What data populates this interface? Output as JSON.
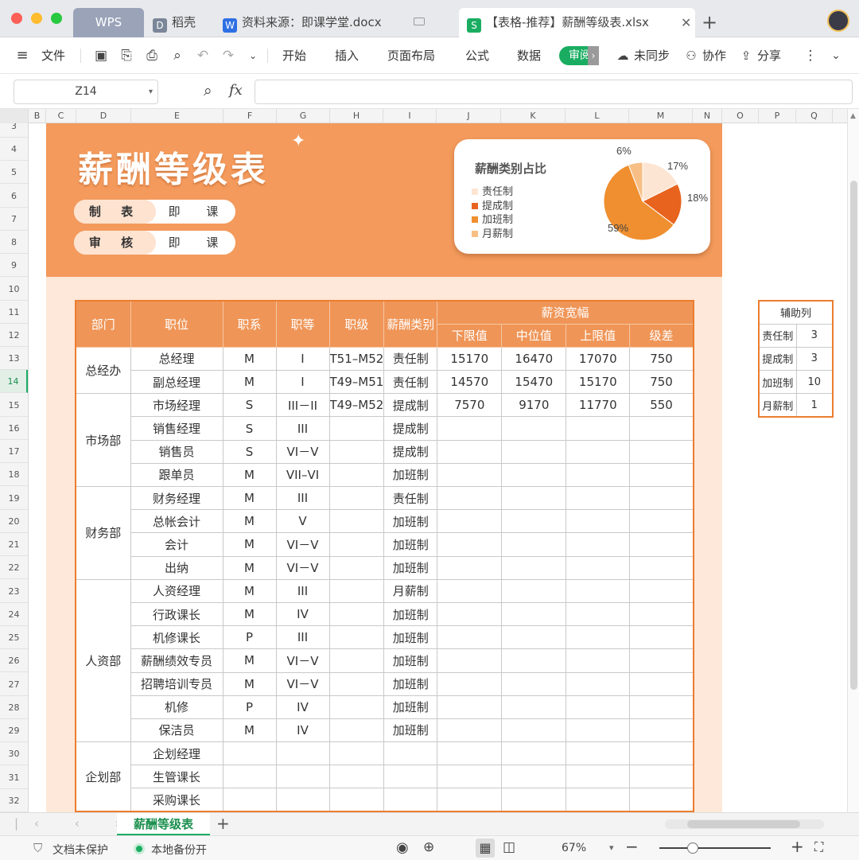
{
  "window": {
    "tabs": [
      {
        "label": "WPS"
      },
      {
        "label": "稻壳"
      },
      {
        "label": "资料来源：即课学堂.docx"
      },
      {
        "label": "【表格-推荐】薪酬等级表.xlsx"
      }
    ],
    "new_tab": "+"
  },
  "toolbar": {
    "file": "文件",
    "menus": [
      "开始",
      "插入",
      "页面布局",
      "公式",
      "数据",
      "审阅"
    ],
    "unsync": "未同步",
    "collab": "协作",
    "share": "分享"
  },
  "formula_bar": {
    "cell_ref": "Z14",
    "fx": "fx",
    "value": ""
  },
  "columns": [
    "B",
    "C",
    "D",
    "E",
    "F",
    "G",
    "H",
    "I",
    "J",
    "K",
    "L",
    "M",
    "N",
    "O",
    "P",
    "Q"
  ],
  "rows": [
    "3",
    "4",
    "5",
    "6",
    "7",
    "8",
    "9",
    "10",
    "11",
    "12",
    "13",
    "14",
    "15",
    "16",
    "17",
    "18",
    "19",
    "20",
    "21",
    "22",
    "23",
    "24",
    "25",
    "26",
    "27",
    "28",
    "29",
    "30",
    "31",
    "32"
  ],
  "banner": {
    "title": "薪酬等级表",
    "star": "✦",
    "made_by_label": "制 表",
    "made_by_value": "即 课",
    "review_label": "审 核",
    "review_value": "即 课"
  },
  "chart_data": {
    "type": "pie",
    "title": "薪酬类别占比",
    "categories": [
      "责任制",
      "提成制",
      "加班制",
      "月薪制"
    ],
    "values": [
      3,
      3,
      10,
      1
    ],
    "percent_labels": [
      "17%",
      "18%",
      "59%",
      "6%"
    ],
    "colors": [
      "#fde5d3",
      "#e8641e",
      "#ef8f2f",
      "#f7bf85"
    ],
    "legend": "left"
  },
  "table": {
    "headers": {
      "dept": "部门",
      "position": "职位",
      "family": "职系",
      "grade": "职等",
      "level": "职级",
      "pay_type": "薪酬类别",
      "range": "薪资宽幅",
      "min": "下限值",
      "mid": "中位值",
      "max": "上限值",
      "diff": "级差"
    },
    "departments": [
      {
        "name": "总经办",
        "rows": [
          {
            "position": "总经理",
            "family": "M",
            "grade": "I",
            "level": "T51–M52",
            "pay_type": "责任制",
            "min": "15170",
            "mid": "16470",
            "max": "17070",
            "diff": "750"
          },
          {
            "position": "副总经理",
            "family": "M",
            "grade": "I",
            "level": "T49–M51",
            "pay_type": "责任制",
            "min": "14570",
            "mid": "15470",
            "max": "15170",
            "diff": "750"
          }
        ]
      },
      {
        "name": "市场部",
        "rows": [
          {
            "position": "市场经理",
            "family": "S",
            "grade": "III－II",
            "level": "T49–M52",
            "pay_type": "提成制",
            "min": "7570",
            "mid": "9170",
            "max": "11770",
            "diff": "550"
          },
          {
            "position": "销售经理",
            "family": "S",
            "grade": "III",
            "level": "",
            "pay_type": "提成制",
            "min": "",
            "mid": "",
            "max": "",
            "diff": ""
          },
          {
            "position": "销售员",
            "family": "S",
            "grade": "VI－V",
            "level": "",
            "pay_type": "提成制",
            "min": "",
            "mid": "",
            "max": "",
            "diff": ""
          },
          {
            "position": "跟单员",
            "family": "M",
            "grade": "VII–VI",
            "level": "",
            "pay_type": "加班制",
            "min": "",
            "mid": "",
            "max": "",
            "diff": ""
          }
        ]
      },
      {
        "name": "财务部",
        "rows": [
          {
            "position": "财务经理",
            "family": "M",
            "grade": "III",
            "level": "",
            "pay_type": "责任制",
            "min": "",
            "mid": "",
            "max": "",
            "diff": ""
          },
          {
            "position": "总帐会计",
            "family": "M",
            "grade": "V",
            "level": "",
            "pay_type": "加班制",
            "min": "",
            "mid": "",
            "max": "",
            "diff": ""
          },
          {
            "position": "会计",
            "family": "M",
            "grade": "VI－V",
            "level": "",
            "pay_type": "加班制",
            "min": "",
            "mid": "",
            "max": "",
            "diff": ""
          },
          {
            "position": "出纳",
            "family": "M",
            "grade": "VI－V",
            "level": "",
            "pay_type": "加班制",
            "min": "",
            "mid": "",
            "max": "",
            "diff": ""
          }
        ]
      },
      {
        "name": "人资部",
        "rows": [
          {
            "position": "人资经理",
            "family": "M",
            "grade": "III",
            "level": "",
            "pay_type": "月薪制",
            "min": "",
            "mid": "",
            "max": "",
            "diff": ""
          },
          {
            "position": "行政课长",
            "family": "M",
            "grade": "IV",
            "level": "",
            "pay_type": "加班制",
            "min": "",
            "mid": "",
            "max": "",
            "diff": ""
          },
          {
            "position": "机修课长",
            "family": "P",
            "grade": "III",
            "level": "",
            "pay_type": "加班制",
            "min": "",
            "mid": "",
            "max": "",
            "diff": ""
          },
          {
            "position": "薪酬绩效专员",
            "family": "M",
            "grade": "VI－V",
            "level": "",
            "pay_type": "加班制",
            "min": "",
            "mid": "",
            "max": "",
            "diff": ""
          },
          {
            "position": "招聘培训专员",
            "family": "M",
            "grade": "VI－V",
            "level": "",
            "pay_type": "加班制",
            "min": "",
            "mid": "",
            "max": "",
            "diff": ""
          },
          {
            "position": "机修",
            "family": "P",
            "grade": "IV",
            "level": "",
            "pay_type": "加班制",
            "min": "",
            "mid": "",
            "max": "",
            "diff": ""
          },
          {
            "position": "保洁员",
            "family": "M",
            "grade": "IV",
            "level": "",
            "pay_type": "加班制",
            "min": "",
            "mid": "",
            "max": "",
            "diff": ""
          }
        ]
      },
      {
        "name": "企划部",
        "rows": [
          {
            "position": "企划经理",
            "family": "",
            "grade": "",
            "level": "",
            "pay_type": "",
            "min": "",
            "mid": "",
            "max": "",
            "diff": ""
          },
          {
            "position": "生管课长",
            "family": "",
            "grade": "",
            "level": "",
            "pay_type": "",
            "min": "",
            "mid": "",
            "max": "",
            "diff": ""
          },
          {
            "position": "采购课长",
            "family": "",
            "grade": "",
            "level": "",
            "pay_type": "",
            "min": "",
            "mid": "",
            "max": "",
            "diff": ""
          }
        ]
      }
    ]
  },
  "aux": {
    "title": "辅助列",
    "rows": [
      {
        "label": "责任制",
        "value": "3"
      },
      {
        "label": "提成制",
        "value": "3"
      },
      {
        "label": "加班制",
        "value": "10"
      },
      {
        "label": "月薪制",
        "value": "1"
      }
    ]
  },
  "sheet_tabs": {
    "active": "薪酬等级表",
    "add": "+"
  },
  "status": {
    "protect": "文档未保护",
    "backup": "本地备份开",
    "zoom": "67%"
  }
}
